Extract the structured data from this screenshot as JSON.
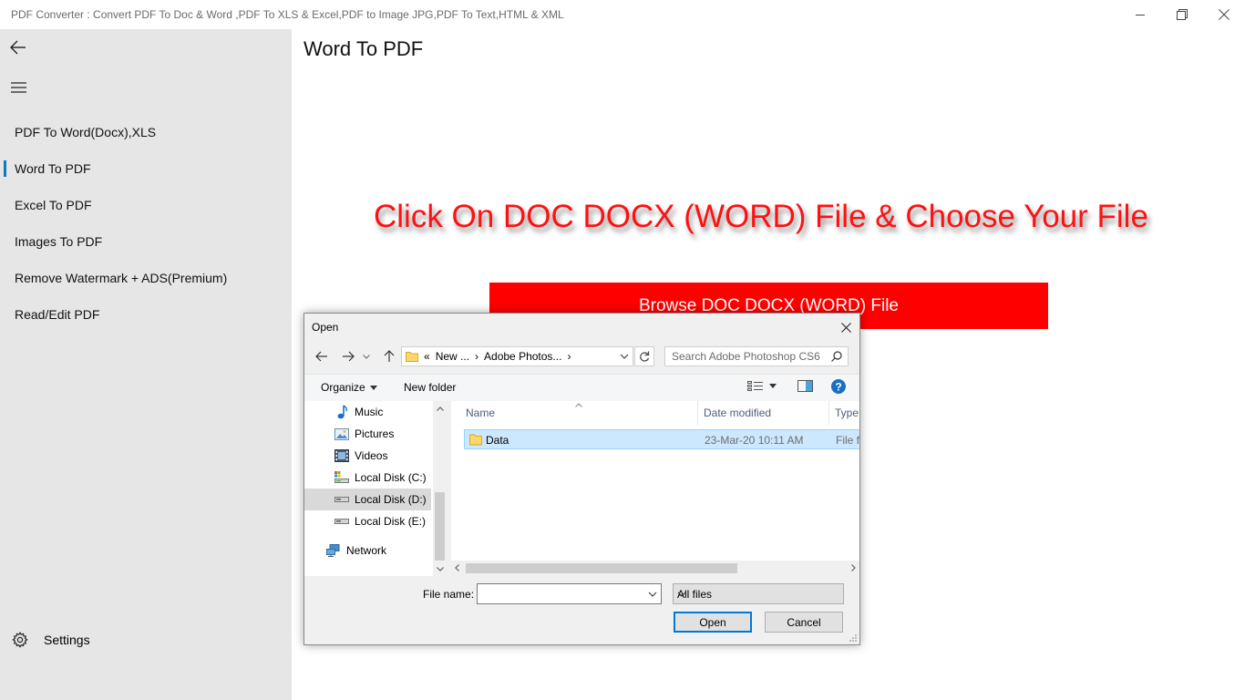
{
  "window": {
    "title": "PDF Converter : Convert PDF To Doc & Word ,PDF To XLS & Excel,PDF to Image JPG,PDF To Text,HTML & XML"
  },
  "sidebar": {
    "items": [
      {
        "label": "PDF To Word(Docx),XLS"
      },
      {
        "label": "Word To PDF"
      },
      {
        "label": "Excel To PDF"
      },
      {
        "label": "Images To PDF"
      },
      {
        "label": "Remove Watermark + ADS(Premium)"
      },
      {
        "label": "Read/Edit PDF"
      }
    ],
    "settings_label": "Settings",
    "active_index": 1
  },
  "main": {
    "page_title": "Word To PDF",
    "headline": "Click On DOC DOCX (WORD) File & Choose Your File",
    "browse_button": "Browse DOC DOCX (WORD) File"
  },
  "dialog": {
    "title": "Open",
    "breadcrumb": {
      "prefix": "«",
      "parts": [
        "New ...",
        "Adobe Photos..."
      ]
    },
    "search_placeholder": "Search Adobe Photoshop CS6",
    "organize_label": "Organize",
    "new_folder_label": "New folder",
    "tree": [
      {
        "label": "Music",
        "icon": "music-icon"
      },
      {
        "label": "Pictures",
        "icon": "pictures-icon"
      },
      {
        "label": "Videos",
        "icon": "videos-icon"
      },
      {
        "label": "Local Disk (C:)",
        "icon": "system-drive-icon"
      },
      {
        "label": "Local Disk (D:)",
        "icon": "drive-icon",
        "selected": true
      },
      {
        "label": "Local Disk (E:)",
        "icon": "drive-icon"
      },
      {
        "label": "Network",
        "icon": "network-icon"
      }
    ],
    "columns": {
      "name": "Name",
      "date": "Date modified",
      "type": "Type"
    },
    "files": [
      {
        "name": "Data",
        "date": "23-Mar-20 10:11 AM",
        "type": "File fo"
      }
    ],
    "file_name_label": "File name:",
    "file_name_value": "",
    "filter_value": "All files",
    "open_label": "Open",
    "cancel_label": "Cancel"
  },
  "colors": {
    "sidebar_bg": "#e6e6e6",
    "accent": "#0a7ac2",
    "headline": "#ff1111",
    "browse_bg": "#ff0000",
    "selection": "#cce8ff"
  }
}
